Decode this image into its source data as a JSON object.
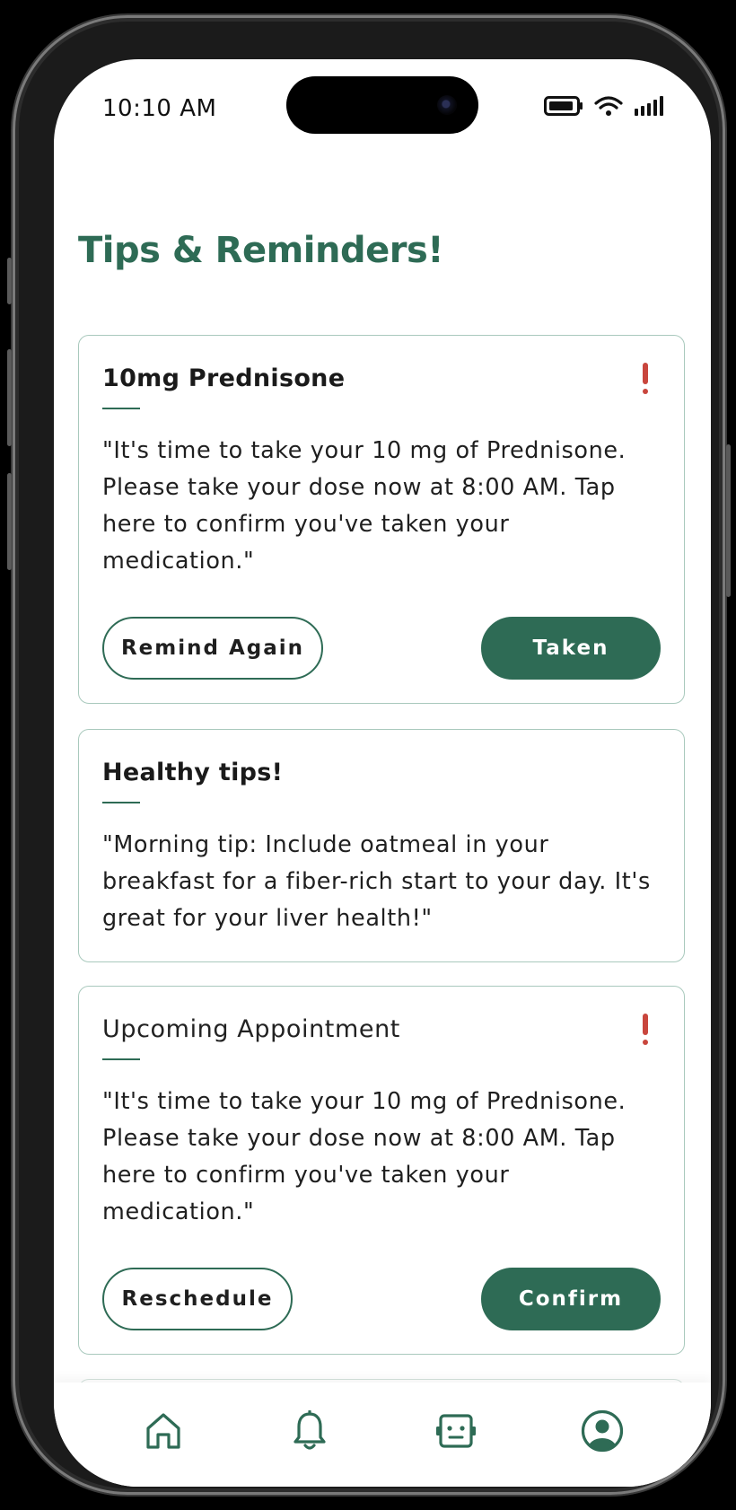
{
  "status_bar": {
    "time": "10:10 AM"
  },
  "page": {
    "title": "Tips & Reminders!"
  },
  "cards": [
    {
      "title": "10mg Prednisone",
      "has_alert": true,
      "body": "\"It's time to take your 10 mg of Prednisone. Please take your dose now at 8:00 AM. Tap here to confirm you've taken your medication.\"",
      "secondary_button": "Remind Again",
      "primary_button": "Taken"
    },
    {
      "title": "Healthy tips!",
      "has_alert": false,
      "body": "\"Morning tip: Include oatmeal in your breakfast for a fiber-rich start to your day. It's great for your liver health!\""
    },
    {
      "title": "Upcoming Appointment",
      "has_alert": true,
      "body": "\"It's time to take your 10 mg of Prednisone. Please take your dose now at 8:00 AM. Tap here to confirm you've taken your medication.\"",
      "secondary_button": "Reschedule",
      "primary_button": "Confirm"
    }
  ],
  "bottom_nav": {
    "items": [
      {
        "icon": "home-icon"
      },
      {
        "icon": "bell-icon"
      },
      {
        "icon": "bot-icon"
      },
      {
        "icon": "profile-icon",
        "active": true
      }
    ]
  },
  "colors": {
    "brand": "#2e6b55",
    "alert": "#c9463d",
    "card_border": "#a9c9bd",
    "text": "#1f1f1f"
  }
}
